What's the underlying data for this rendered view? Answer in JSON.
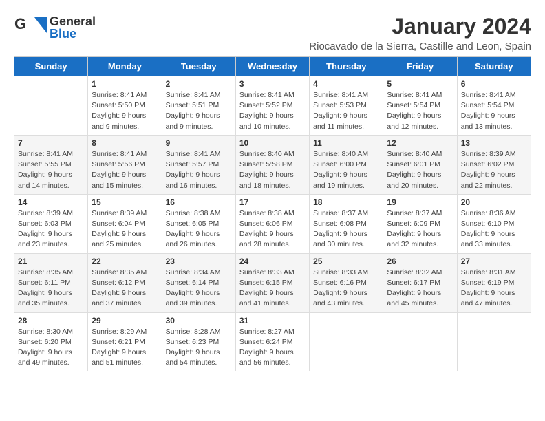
{
  "header": {
    "logo_line1": "General",
    "logo_line2": "Blue",
    "main_title": "January 2024",
    "subtitle": "Riocavado de la Sierra, Castille and Leon, Spain"
  },
  "calendar": {
    "days_of_week": [
      "Sunday",
      "Monday",
      "Tuesday",
      "Wednesday",
      "Thursday",
      "Friday",
      "Saturday"
    ],
    "weeks": [
      [
        {
          "day": "",
          "info": ""
        },
        {
          "day": "1",
          "info": "Sunrise: 8:41 AM\nSunset: 5:50 PM\nDaylight: 9 hours\nand 9 minutes."
        },
        {
          "day": "2",
          "info": "Sunrise: 8:41 AM\nSunset: 5:51 PM\nDaylight: 9 hours\nand 9 minutes."
        },
        {
          "day": "3",
          "info": "Sunrise: 8:41 AM\nSunset: 5:52 PM\nDaylight: 9 hours\nand 10 minutes."
        },
        {
          "day": "4",
          "info": "Sunrise: 8:41 AM\nSunset: 5:53 PM\nDaylight: 9 hours\nand 11 minutes."
        },
        {
          "day": "5",
          "info": "Sunrise: 8:41 AM\nSunset: 5:54 PM\nDaylight: 9 hours\nand 12 minutes."
        },
        {
          "day": "6",
          "info": "Sunrise: 8:41 AM\nSunset: 5:54 PM\nDaylight: 9 hours\nand 13 minutes."
        }
      ],
      [
        {
          "day": "7",
          "info": "Sunrise: 8:41 AM\nSunset: 5:55 PM\nDaylight: 9 hours\nand 14 minutes."
        },
        {
          "day": "8",
          "info": "Sunrise: 8:41 AM\nSunset: 5:56 PM\nDaylight: 9 hours\nand 15 minutes."
        },
        {
          "day": "9",
          "info": "Sunrise: 8:41 AM\nSunset: 5:57 PM\nDaylight: 9 hours\nand 16 minutes."
        },
        {
          "day": "10",
          "info": "Sunrise: 8:40 AM\nSunset: 5:58 PM\nDaylight: 9 hours\nand 18 minutes."
        },
        {
          "day": "11",
          "info": "Sunrise: 8:40 AM\nSunset: 6:00 PM\nDaylight: 9 hours\nand 19 minutes."
        },
        {
          "day": "12",
          "info": "Sunrise: 8:40 AM\nSunset: 6:01 PM\nDaylight: 9 hours\nand 20 minutes."
        },
        {
          "day": "13",
          "info": "Sunrise: 8:39 AM\nSunset: 6:02 PM\nDaylight: 9 hours\nand 22 minutes."
        }
      ],
      [
        {
          "day": "14",
          "info": "Sunrise: 8:39 AM\nSunset: 6:03 PM\nDaylight: 9 hours\nand 23 minutes."
        },
        {
          "day": "15",
          "info": "Sunrise: 8:39 AM\nSunset: 6:04 PM\nDaylight: 9 hours\nand 25 minutes."
        },
        {
          "day": "16",
          "info": "Sunrise: 8:38 AM\nSunset: 6:05 PM\nDaylight: 9 hours\nand 26 minutes."
        },
        {
          "day": "17",
          "info": "Sunrise: 8:38 AM\nSunset: 6:06 PM\nDaylight: 9 hours\nand 28 minutes."
        },
        {
          "day": "18",
          "info": "Sunrise: 8:37 AM\nSunset: 6:08 PM\nDaylight: 9 hours\nand 30 minutes."
        },
        {
          "day": "19",
          "info": "Sunrise: 8:37 AM\nSunset: 6:09 PM\nDaylight: 9 hours\nand 32 minutes."
        },
        {
          "day": "20",
          "info": "Sunrise: 8:36 AM\nSunset: 6:10 PM\nDaylight: 9 hours\nand 33 minutes."
        }
      ],
      [
        {
          "day": "21",
          "info": "Sunrise: 8:35 AM\nSunset: 6:11 PM\nDaylight: 9 hours\nand 35 minutes."
        },
        {
          "day": "22",
          "info": "Sunrise: 8:35 AM\nSunset: 6:12 PM\nDaylight: 9 hours\nand 37 minutes."
        },
        {
          "day": "23",
          "info": "Sunrise: 8:34 AM\nSunset: 6:14 PM\nDaylight: 9 hours\nand 39 minutes."
        },
        {
          "day": "24",
          "info": "Sunrise: 8:33 AM\nSunset: 6:15 PM\nDaylight: 9 hours\nand 41 minutes."
        },
        {
          "day": "25",
          "info": "Sunrise: 8:33 AM\nSunset: 6:16 PM\nDaylight: 9 hours\nand 43 minutes."
        },
        {
          "day": "26",
          "info": "Sunrise: 8:32 AM\nSunset: 6:17 PM\nDaylight: 9 hours\nand 45 minutes."
        },
        {
          "day": "27",
          "info": "Sunrise: 8:31 AM\nSunset: 6:19 PM\nDaylight: 9 hours\nand 47 minutes."
        }
      ],
      [
        {
          "day": "28",
          "info": "Sunrise: 8:30 AM\nSunset: 6:20 PM\nDaylight: 9 hours\nand 49 minutes."
        },
        {
          "day": "29",
          "info": "Sunrise: 8:29 AM\nSunset: 6:21 PM\nDaylight: 9 hours\nand 51 minutes."
        },
        {
          "day": "30",
          "info": "Sunrise: 8:28 AM\nSunset: 6:23 PM\nDaylight: 9 hours\nand 54 minutes."
        },
        {
          "day": "31",
          "info": "Sunrise: 8:27 AM\nSunset: 6:24 PM\nDaylight: 9 hours\nand 56 minutes."
        },
        {
          "day": "",
          "info": ""
        },
        {
          "day": "",
          "info": ""
        },
        {
          "day": "",
          "info": ""
        }
      ]
    ]
  }
}
